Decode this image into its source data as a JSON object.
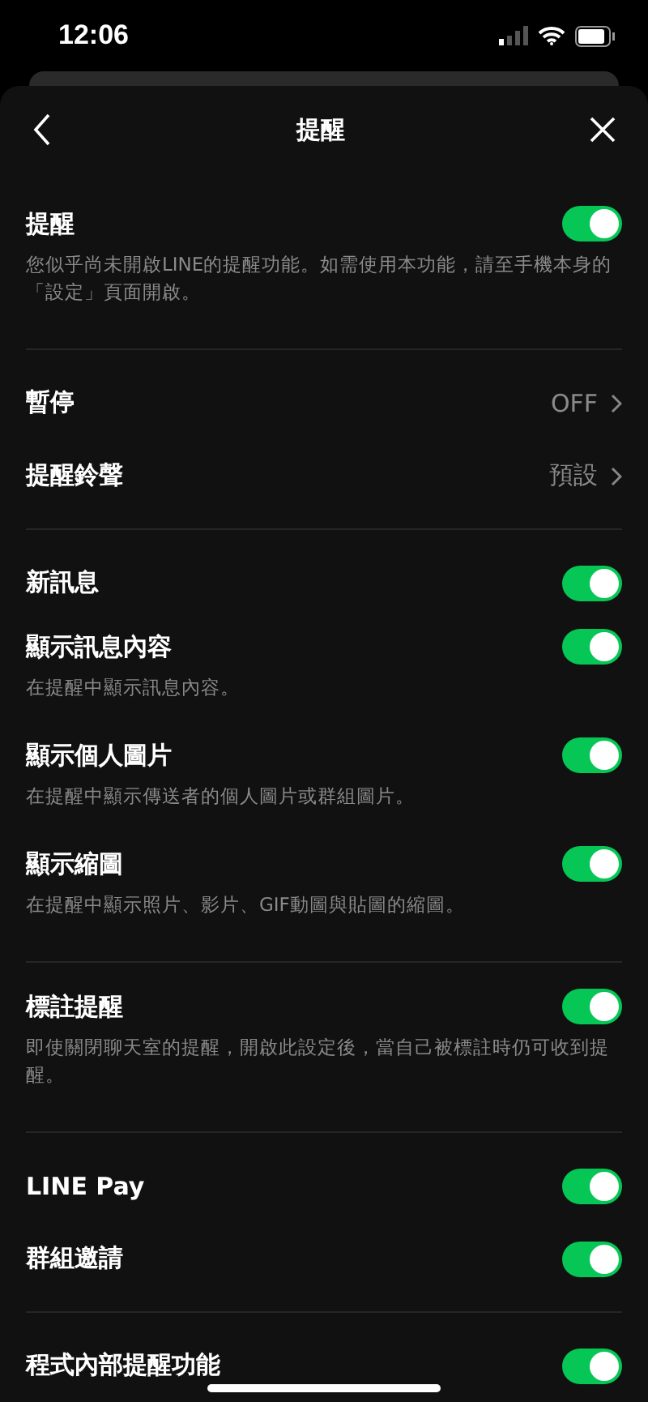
{
  "status_bar": {
    "time": "12:06"
  },
  "header": {
    "title": "提醒"
  },
  "sections": [
    {
      "items": [
        {
          "kind": "toggle",
          "label": "提醒",
          "on": true,
          "description": "您似乎尚未開啟LINE的提醒功能。如需使用本功能，請至手機本身的「設定」頁面開啟。"
        }
      ]
    },
    {
      "items": [
        {
          "kind": "link",
          "label": "暫停",
          "value": "OFF"
        },
        {
          "kind": "link",
          "label": "提醒鈴聲",
          "value": "預設"
        }
      ]
    },
    {
      "items": [
        {
          "kind": "toggle",
          "label": "新訊息",
          "on": true
        },
        {
          "kind": "toggle",
          "label": "顯示訊息內容",
          "on": true,
          "description": "在提醒中顯示訊息內容。"
        },
        {
          "kind": "toggle",
          "label": "顯示個人圖片",
          "on": true,
          "description": "在提醒中顯示傳送者的個人圖片或群組圖片。"
        },
        {
          "kind": "toggle",
          "label": "顯示縮圖",
          "on": true,
          "description": "在提醒中顯示照片、影片、GIF動圖與貼圖的縮圖。"
        }
      ]
    },
    {
      "items": [
        {
          "kind": "toggle",
          "label": "標註提醒",
          "on": true,
          "description": "即使關閉聊天室的提醒，開啟此設定後，當自己被標註時仍可收到提醒。"
        }
      ]
    },
    {
      "items": [
        {
          "kind": "toggle",
          "label": "LINE Pay",
          "on": true
        },
        {
          "kind": "toggle",
          "label": "群組邀請",
          "on": true
        }
      ]
    },
    {
      "items": [
        {
          "kind": "toggle",
          "label": "程式內部提醒功能",
          "on": true
        }
      ]
    }
  ]
}
